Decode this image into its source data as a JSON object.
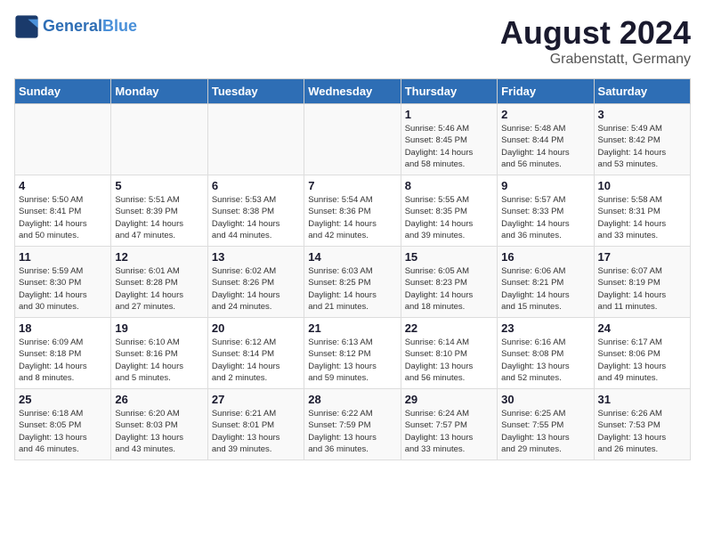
{
  "header": {
    "logo_line1": "General",
    "logo_line2": "Blue",
    "title": "August 2024",
    "subtitle": "Grabenstatt, Germany"
  },
  "calendar": {
    "weekdays": [
      "Sunday",
      "Monday",
      "Tuesday",
      "Wednesday",
      "Thursday",
      "Friday",
      "Saturday"
    ],
    "weeks": [
      [
        {
          "num": "",
          "info": ""
        },
        {
          "num": "",
          "info": ""
        },
        {
          "num": "",
          "info": ""
        },
        {
          "num": "",
          "info": ""
        },
        {
          "num": "1",
          "info": "Sunrise: 5:46 AM\nSunset: 8:45 PM\nDaylight: 14 hours\nand 58 minutes."
        },
        {
          "num": "2",
          "info": "Sunrise: 5:48 AM\nSunset: 8:44 PM\nDaylight: 14 hours\nand 56 minutes."
        },
        {
          "num": "3",
          "info": "Sunrise: 5:49 AM\nSunset: 8:42 PM\nDaylight: 14 hours\nand 53 minutes."
        }
      ],
      [
        {
          "num": "4",
          "info": "Sunrise: 5:50 AM\nSunset: 8:41 PM\nDaylight: 14 hours\nand 50 minutes."
        },
        {
          "num": "5",
          "info": "Sunrise: 5:51 AM\nSunset: 8:39 PM\nDaylight: 14 hours\nand 47 minutes."
        },
        {
          "num": "6",
          "info": "Sunrise: 5:53 AM\nSunset: 8:38 PM\nDaylight: 14 hours\nand 44 minutes."
        },
        {
          "num": "7",
          "info": "Sunrise: 5:54 AM\nSunset: 8:36 PM\nDaylight: 14 hours\nand 42 minutes."
        },
        {
          "num": "8",
          "info": "Sunrise: 5:55 AM\nSunset: 8:35 PM\nDaylight: 14 hours\nand 39 minutes."
        },
        {
          "num": "9",
          "info": "Sunrise: 5:57 AM\nSunset: 8:33 PM\nDaylight: 14 hours\nand 36 minutes."
        },
        {
          "num": "10",
          "info": "Sunrise: 5:58 AM\nSunset: 8:31 PM\nDaylight: 14 hours\nand 33 minutes."
        }
      ],
      [
        {
          "num": "11",
          "info": "Sunrise: 5:59 AM\nSunset: 8:30 PM\nDaylight: 14 hours\nand 30 minutes."
        },
        {
          "num": "12",
          "info": "Sunrise: 6:01 AM\nSunset: 8:28 PM\nDaylight: 14 hours\nand 27 minutes."
        },
        {
          "num": "13",
          "info": "Sunrise: 6:02 AM\nSunset: 8:26 PM\nDaylight: 14 hours\nand 24 minutes."
        },
        {
          "num": "14",
          "info": "Sunrise: 6:03 AM\nSunset: 8:25 PM\nDaylight: 14 hours\nand 21 minutes."
        },
        {
          "num": "15",
          "info": "Sunrise: 6:05 AM\nSunset: 8:23 PM\nDaylight: 14 hours\nand 18 minutes."
        },
        {
          "num": "16",
          "info": "Sunrise: 6:06 AM\nSunset: 8:21 PM\nDaylight: 14 hours\nand 15 minutes."
        },
        {
          "num": "17",
          "info": "Sunrise: 6:07 AM\nSunset: 8:19 PM\nDaylight: 14 hours\nand 11 minutes."
        }
      ],
      [
        {
          "num": "18",
          "info": "Sunrise: 6:09 AM\nSunset: 8:18 PM\nDaylight: 14 hours\nand 8 minutes."
        },
        {
          "num": "19",
          "info": "Sunrise: 6:10 AM\nSunset: 8:16 PM\nDaylight: 14 hours\nand 5 minutes."
        },
        {
          "num": "20",
          "info": "Sunrise: 6:12 AM\nSunset: 8:14 PM\nDaylight: 14 hours\nand 2 minutes."
        },
        {
          "num": "21",
          "info": "Sunrise: 6:13 AM\nSunset: 8:12 PM\nDaylight: 13 hours\nand 59 minutes."
        },
        {
          "num": "22",
          "info": "Sunrise: 6:14 AM\nSunset: 8:10 PM\nDaylight: 13 hours\nand 56 minutes."
        },
        {
          "num": "23",
          "info": "Sunrise: 6:16 AM\nSunset: 8:08 PM\nDaylight: 13 hours\nand 52 minutes."
        },
        {
          "num": "24",
          "info": "Sunrise: 6:17 AM\nSunset: 8:06 PM\nDaylight: 13 hours\nand 49 minutes."
        }
      ],
      [
        {
          "num": "25",
          "info": "Sunrise: 6:18 AM\nSunset: 8:05 PM\nDaylight: 13 hours\nand 46 minutes."
        },
        {
          "num": "26",
          "info": "Sunrise: 6:20 AM\nSunset: 8:03 PM\nDaylight: 13 hours\nand 43 minutes."
        },
        {
          "num": "27",
          "info": "Sunrise: 6:21 AM\nSunset: 8:01 PM\nDaylight: 13 hours\nand 39 minutes."
        },
        {
          "num": "28",
          "info": "Sunrise: 6:22 AM\nSunset: 7:59 PM\nDaylight: 13 hours\nand 36 minutes."
        },
        {
          "num": "29",
          "info": "Sunrise: 6:24 AM\nSunset: 7:57 PM\nDaylight: 13 hours\nand 33 minutes."
        },
        {
          "num": "30",
          "info": "Sunrise: 6:25 AM\nSunset: 7:55 PM\nDaylight: 13 hours\nand 29 minutes."
        },
        {
          "num": "31",
          "info": "Sunrise: 6:26 AM\nSunset: 7:53 PM\nDaylight: 13 hours\nand 26 minutes."
        }
      ]
    ]
  }
}
